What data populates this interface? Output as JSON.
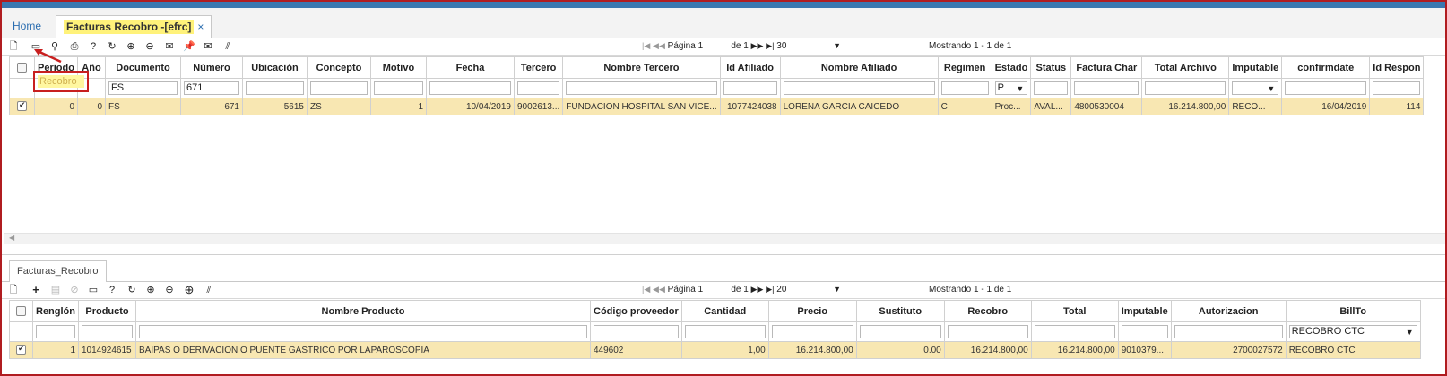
{
  "tabs": {
    "home": "Home",
    "active": "Facturas Recobro -[efrc]",
    "close": "×"
  },
  "top_pager": {
    "first": "|◀",
    "prev": "◀◀",
    "page_label": "Página",
    "page_value": "1",
    "of": "de 1",
    "next": "▶▶",
    "last": "▶|",
    "page_size": "30",
    "caret": "▼",
    "showing": "Mostrando 1 - 1 de 1"
  },
  "top_grid": {
    "headers": [
      "Periodo",
      "Año",
      "Documento",
      "Número",
      "Ubicación",
      "Concepto",
      "Motivo",
      "Fecha",
      "Tercero",
      "Nombre Tercero",
      "Id Afiliado",
      "Nombre Afiliado",
      "Regimen",
      "Estado",
      "Status",
      "Factura Char",
      "Total Archivo",
      "Imputable",
      "confirmdate",
      "Id Respon"
    ],
    "filters": {
      "periodo": "Recobro",
      "documento": "FS",
      "numero": "671",
      "estado": "P"
    },
    "row": [
      "0",
      "0",
      "FS",
      "671",
      "5615",
      "ZS",
      "1",
      "10/04/2019",
      "9002613...",
      "FUNDACION HOSPITAL SAN VICE...",
      "1077424038",
      "LORENA GARCIA CAICEDO",
      "C",
      "Proc...",
      "AVAL...",
      "4800530004",
      "16.214.800,00",
      "RECO...",
      "16/04/2019",
      "114"
    ]
  },
  "sub_tab": "Facturas_Recobro",
  "bottom_pager": {
    "first": "|◀",
    "prev": "◀◀",
    "page_label": "Página",
    "page_value": "1",
    "of": "de 1",
    "next": "▶▶",
    "last": "▶|",
    "page_size": "20",
    "caret": "▼",
    "showing": "Mostrando 1 - 1 de 1"
  },
  "bottom_grid": {
    "headers": [
      "Renglón",
      "Producto",
      "Nombre Producto",
      "Código proveedor",
      "Cantidad",
      "Precio",
      "Sustituto",
      "Recobro",
      "Total",
      "Imputable",
      "Autorizacion",
      "BillTo"
    ],
    "filters": {
      "billto": "RECOBRO CTC"
    },
    "row": [
      "1",
      "1014924615",
      "BAIPAS O DERIVACION O PUENTE GASTRICO POR LAPAROSCOPIA",
      "449602",
      "1,00",
      "16.214.800,00",
      "0.00",
      "16.214.800,00",
      "16.214.800,00",
      "9010379...",
      "2700027572",
      "RECOBRO CTC"
    ]
  },
  "colors": {
    "accent": "#3a78b0",
    "row_selected": "#f8e7b2",
    "tab_highlight": "#fff27a",
    "callout": "#c81f1f"
  }
}
